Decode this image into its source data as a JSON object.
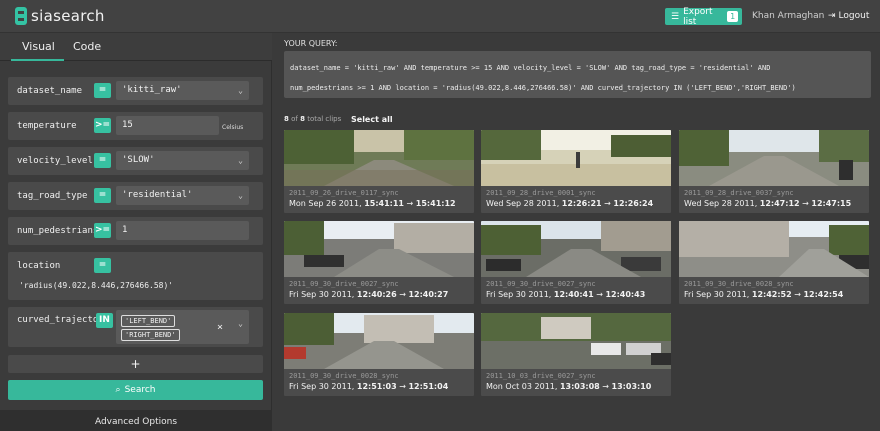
{
  "header": {
    "logo_text": "siasearch",
    "export_label": "Export list",
    "export_count": "1",
    "user_name": "Khan Armaghan",
    "logout_label": "Logout"
  },
  "tabs": {
    "visual": "Visual",
    "code": "Code"
  },
  "filters": {
    "dataset_name": {
      "label": "dataset_name",
      "op": "=",
      "value": "'kitti_raw'"
    },
    "temperature": {
      "label": "temperature",
      "op": ">=",
      "value": "15",
      "unit": "Celsius"
    },
    "velocity_level": {
      "label": "velocity_level",
      "op": "=",
      "value": "'SLOW'"
    },
    "tag_road_type": {
      "label": "tag_road_type",
      "op": "=",
      "value": "'residential'"
    },
    "num_pedestrians": {
      "label": "num_pedestrians",
      "op": ">=",
      "value": "1"
    },
    "location": {
      "label": "location",
      "op": "=",
      "value": "'radius(49.022,8.446,276466.58)'"
    },
    "curved_trajectory": {
      "label": "curved_trajectory",
      "op": "IN",
      "tags": [
        "'LEFT_BEND'",
        "'RIGHT_BEND'"
      ]
    }
  },
  "actions": {
    "add": "+",
    "search": "Search",
    "advanced": "Advanced Options"
  },
  "query": {
    "title": "YOUR QUERY:",
    "line1": "dataset_name = 'kitti_raw' AND temperature >= 15 AND velocity_level = 'SLOW' AND tag_road_type = 'residential' AND",
    "line2": "num_pedestrians >= 1 AND location = 'radius(49.022,8.446,276466.58)' AND curved_trajectory IN ('LEFT_BEND','RIGHT_BEND')"
  },
  "results": {
    "shown": "8",
    "of": "of",
    "total": "8",
    "total_suffix": "total clips",
    "select_all": "Select all"
  },
  "clips": [
    {
      "id": "2011_09_26_drive_0117_sync",
      "date": "Mon Sep 26 2011, ",
      "start": "15:41:11",
      "arrow": " → ",
      "end": "15:41:12"
    },
    {
      "id": "2011_09_28_drive_0001_sync",
      "date": "Wed Sep 28 2011, ",
      "start": "12:26:21",
      "arrow": " → ",
      "end": "12:26:24"
    },
    {
      "id": "2011_09_28_drive_0037_sync",
      "date": "Wed Sep 28 2011, ",
      "start": "12:47:12",
      "arrow": " → ",
      "end": "12:47:15"
    },
    {
      "id": "2011_09_30_drive_0027_sync",
      "date": "Fri Sep 30 2011, ",
      "start": "12:40:26",
      "arrow": " → ",
      "end": "12:40:27"
    },
    {
      "id": "2011_09_30_drive_0027_sync",
      "date": "Fri Sep 30 2011, ",
      "start": "12:40:41",
      "arrow": " → ",
      "end": "12:40:43"
    },
    {
      "id": "2011_09_30_drive_0028_sync",
      "date": "Fri Sep 30 2011, ",
      "start": "12:42:52",
      "arrow": " → ",
      "end": "12:42:54"
    },
    {
      "id": "2011_09_30_drive_0028_sync",
      "date": "Fri Sep 30 2011, ",
      "start": "12:51:03",
      "arrow": " → ",
      "end": "12:51:04"
    },
    {
      "id": "2011_10_03_drive_0027_sync",
      "date": "Mon Oct 03 2011, ",
      "start": "13:03:08",
      "arrow": " → ",
      "end": "13:03:10"
    }
  ],
  "colors": {
    "accent": "#37b89b",
    "background": "#3a3a3a",
    "panel": "#4a4a4a"
  },
  "icons": {
    "export": "list-icon",
    "logout": "logout-icon",
    "search": "search-icon",
    "chevron": "chevron-down-icon",
    "clear": "close-icon"
  }
}
